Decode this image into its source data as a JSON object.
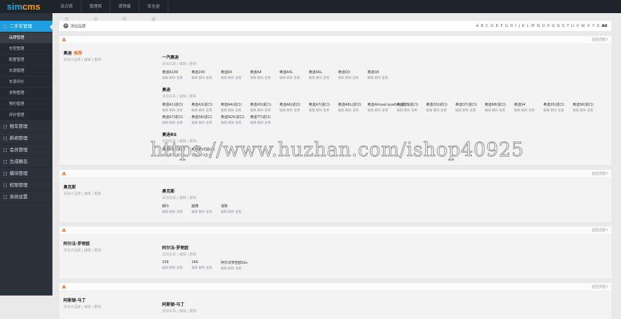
{
  "logo": {
    "a": "sim",
    "b": "cms"
  },
  "topnav": [
    "站点首页",
    "管理首页",
    "清除缓存",
    "安全退出"
  ],
  "sidebar": {
    "active": "二手车管理",
    "subs": [
      "品牌管理",
      "车型管理",
      "配置管理",
      "车源管理",
      "车源评价",
      "求购管理",
      "预约管理",
      "评价管理"
    ],
    "groups": [
      "租车管理",
      "新闻管理",
      "会员管理",
      "生成静态",
      "模块管理",
      "权限管理",
      "系统设置"
    ]
  },
  "toolbar": {
    "add": "添加品牌",
    "letters": [
      "A",
      "B",
      "C",
      "D",
      "E",
      "F",
      "G",
      "H",
      "I",
      "J",
      "K",
      "L",
      "M",
      "N",
      "O",
      "P",
      "Q",
      "R",
      "S",
      "T",
      "U",
      "V",
      "W",
      "X",
      "Y",
      "Z",
      "All"
    ]
  },
  "back_top": "返回顶部↑",
  "brand_actions": "添加子品牌 | 编辑 | 删除",
  "series_actions": "添加车系 | 编辑 | 删除",
  "model_actions": "编辑 删除 查看",
  "sections": [
    {
      "letter": "A",
      "brand": "奥迪",
      "tag": "推荐",
      "series": [
        {
          "name": "一汽奥迪",
          "models": [
            "奥迪A100",
            "奥迪200",
            "奥迪A3",
            "奥迪A4",
            "奥迪A4L",
            "奥迪A6L",
            "奥迪Q3",
            "奥迪Q5"
          ]
        },
        {
          "name": "奥迪",
          "models": [
            "奥迪A1(进口)",
            "奥迪A3(进口)",
            "奥迪A4(进口)",
            "奥迪A5(进口)",
            "奥迪A6(进口)",
            "奥迪A7(进口)",
            "奥迪A8L(进口)",
            "奥迪Allroad quattro(进口)",
            "奥迪Q3(进口)",
            "奥迪Q5(进口)",
            "奥迪Q7(进口)",
            "奥迪R8(进口)",
            "奥迪S4",
            "奥迪S5(进口)",
            "奥迪S6(进口)",
            "奥迪S7(进口)",
            "奥迪S8(进口)",
            "奥迪SQ5(进口)",
            "奥迪TT(进口)"
          ]
        },
        {
          "name": "奥迪RS",
          "models": [
            "奥迪RS5(进口)",
            "奥迪RS7(进口)"
          ]
        }
      ]
    },
    {
      "letter": "A",
      "brand": "奥克斯",
      "tag": "",
      "series": [
        {
          "name": "奥克斯",
          "models": [
            "朗众",
            "越博",
            "凌致"
          ]
        }
      ]
    },
    {
      "letter": "A",
      "brand": "阿尔法·罗密欧",
      "tag": "",
      "series": [
        {
          "name": "阿尔法·罗密欧",
          "models": [
            "156",
            "166",
            "阿尔法罗密欧Gtv"
          ]
        }
      ]
    },
    {
      "letter": "A",
      "brand": "阿斯顿·马丁",
      "tag": "",
      "series": [
        {
          "name": "阿斯顿·马丁",
          "models": []
        }
      ]
    }
  ],
  "watermark": "https://www.huzhan.com/ishop40925"
}
